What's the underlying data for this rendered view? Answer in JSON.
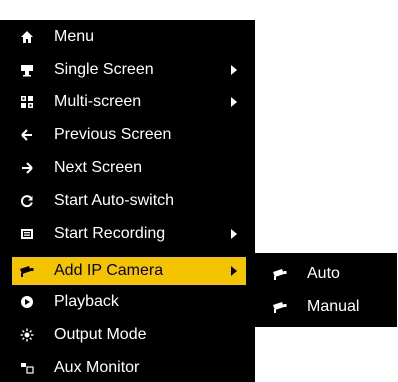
{
  "menu": {
    "items": [
      {
        "label": "Menu",
        "icon": "home-icon",
        "submenu": false
      },
      {
        "label": "Single Screen",
        "icon": "monitor-icon",
        "submenu": true
      },
      {
        "label": "Multi-screen",
        "icon": "multi-screen-icon",
        "submenu": true
      },
      {
        "label": "Previous Screen",
        "icon": "arrow-left-icon",
        "submenu": false
      },
      {
        "label": "Next Screen",
        "icon": "arrow-right-icon",
        "submenu": false
      },
      {
        "label": "Start Auto-switch",
        "icon": "refresh-icon",
        "submenu": false
      },
      {
        "label": "Start Recording",
        "icon": "record-icon",
        "submenu": true
      },
      {
        "label": "Add IP Camera",
        "icon": "camera-icon",
        "submenu": true,
        "selected": true
      },
      {
        "label": "Playback",
        "icon": "playback-icon",
        "submenu": false
      },
      {
        "label": "Output Mode",
        "icon": "output-mode-icon",
        "submenu": false
      },
      {
        "label": "Aux Monitor",
        "icon": "aux-monitor-icon",
        "submenu": false
      }
    ]
  },
  "submenu": {
    "items": [
      {
        "label": "Auto",
        "icon": "camera-icon"
      },
      {
        "label": "Manual",
        "icon": "camera-icon"
      }
    ]
  },
  "colors": {
    "menu_background": "#000000",
    "selected_background": "#f5c400",
    "text": "#ffffff",
    "selected_text": "#000000"
  }
}
